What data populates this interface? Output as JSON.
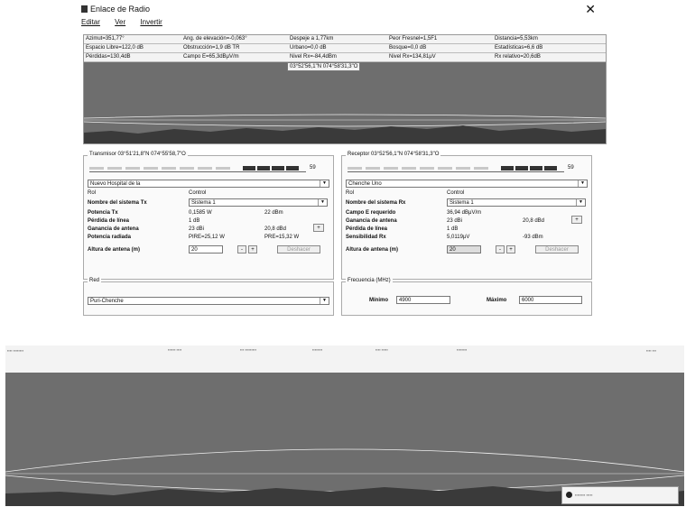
{
  "window": {
    "title": "Enlace de Radio",
    "close": "✕",
    "icon": "app-icon"
  },
  "menu": {
    "items": [
      "Editar",
      "Ver",
      "Invertir"
    ]
  },
  "info_rows": [
    [
      "Azimut=351,77°",
      "Ang. de elevación=-0,063°",
      "Despeje a 1,77km",
      "Peor Fresnel=1,5F1",
      "Distancia=5,53km"
    ],
    [
      "Espacio Libre=122,0 dB",
      "Obstrucción=1,9 dB TR",
      "Urbano=0,0 dB",
      "Bosque=0,0 dB",
      "Estadísticas=6,6 dB"
    ],
    [
      "Pérdidas=130,4dB",
      "Campo E=65,3dBμV/m",
      "Nivel Rx=-84,4dBm",
      "Nivel Rx=134,81μV",
      "Rx relativo=20,6dB"
    ]
  ],
  "coord_tag": "03°52'56,1\"N 074°58'31,3\"O",
  "transmitter": {
    "legend": "Transmisor 03°51'21,8\"N 074°55'58,7\"O",
    "slider_value": "59",
    "site": "Nuevo Hospital de la",
    "rol_label": "Rol",
    "rol_value": "Control",
    "system_label": "Nombre del sistema Tx",
    "system_value": "Sistema  1",
    "power_label": "Potencia Tx",
    "power_w": "0,1585 W",
    "power_dbm": "22 dBm",
    "loss_label": "Pérdida de línea",
    "loss_value": "1 dB",
    "gain_label": "Ganancia de antena",
    "gain_dbi": "23 dBi",
    "gain_dbd": "20,8 dBd",
    "rad_label": "Potencia radiada",
    "pire": "PIRE=25,12 W",
    "pre": "PRE=15,32 W",
    "height_label": "Altura de antena (m)",
    "height_value": "20",
    "undo": "Deshacer"
  },
  "receiver": {
    "legend": "Receptor 03°52'56,1\"N 074°58'31,3\"O",
    "slider_value": "59",
    "site": "Chenche Uno",
    "rol_label": "Rol",
    "rol_value": "Control",
    "system_label": "Nombre del sistema Rx",
    "system_value": "Sistema  1",
    "field_label": "Campo E requerido",
    "field_value": "36,94 dBμV/m",
    "gain_label": "Ganancia de antena",
    "gain_dbi": "23 dBi",
    "gain_dbd": "20,8 dBd",
    "loss_label": "Pérdida de línea",
    "loss_value": "1 dB",
    "sens_label": "Sensibilidad Rx",
    "sens_uv": "5,0119μV",
    "sens_dbm": "-93 dBm",
    "height_label": "Altura de antena (m)",
    "height_value": "20",
    "undo": "Deshacer"
  },
  "network": {
    "legend": "Red",
    "value": "Puri-Chenche"
  },
  "frequency": {
    "legend": "Frecuencia (MHz)",
    "min_label": "Mínimo",
    "min_value": "4900",
    "max_label": "Máximo",
    "max_value": "6000"
  },
  "colors": {
    "profile_bg": "#6e6e6e",
    "panel_bg": "#fafafa"
  }
}
